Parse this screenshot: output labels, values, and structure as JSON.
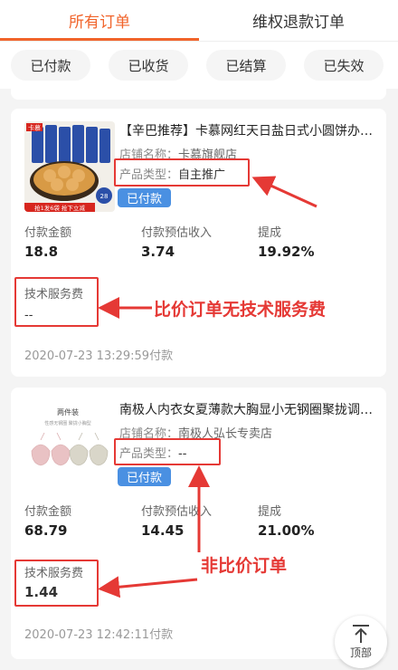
{
  "tabs": [
    {
      "label": "所有订单",
      "active": true
    },
    {
      "label": "维权退款订单",
      "active": false
    }
  ],
  "filters": [
    "已付款",
    "已收货",
    "已结算",
    "已失效"
  ],
  "orders": [
    {
      "title": "【辛巴推荐】卡慕网红天日盐日式小圆饼办…",
      "shop_label": "店铺名称：",
      "shop_name": "卡慕旗舰店",
      "ptype_label": "产品类型：",
      "ptype_value": "自主推广",
      "status": "已付款",
      "stats": [
        {
          "label": "付款金额",
          "value": "18.8"
        },
        {
          "label": "付款预估收入",
          "value": "3.74"
        },
        {
          "label": "提成",
          "value": "19.92%"
        }
      ],
      "fee_label": "技术服务费",
      "fee_value": "--",
      "time": "2020-07-23 13:29:59付款",
      "thumb": {
        "brand": "卡慕",
        "strip": "抢1发6袋  抢下立减",
        "tag": "28"
      }
    },
    {
      "title": "南极人内衣女夏薄款大胸显小无钢圈聚拢调…",
      "shop_label": "店铺名称：",
      "shop_name": "南极人弘长专卖店",
      "ptype_label": "产品类型：",
      "ptype_value": "--",
      "status": "已付款",
      "stats": [
        {
          "label": "付款金额",
          "value": "68.79"
        },
        {
          "label": "付款预估收入",
          "value": "14.45"
        },
        {
          "label": "提成",
          "value": "21.00%"
        }
      ],
      "fee_label": "技术服务费",
      "fee_value": "1.44",
      "time": "2020-07-23 12:42:11付款",
      "thumb": {
        "caption": "两件装",
        "sub": "性感无钢圈  聚拢小胸型"
      }
    }
  ],
  "annotations": {
    "no_fee": "比价订单无技术服务费",
    "non_compare": "非比价订单"
  },
  "back_to_top": "顶部",
  "colors": {
    "accent": "#f1642b",
    "badge": "#4a90e2",
    "annotation": "#e53935"
  }
}
